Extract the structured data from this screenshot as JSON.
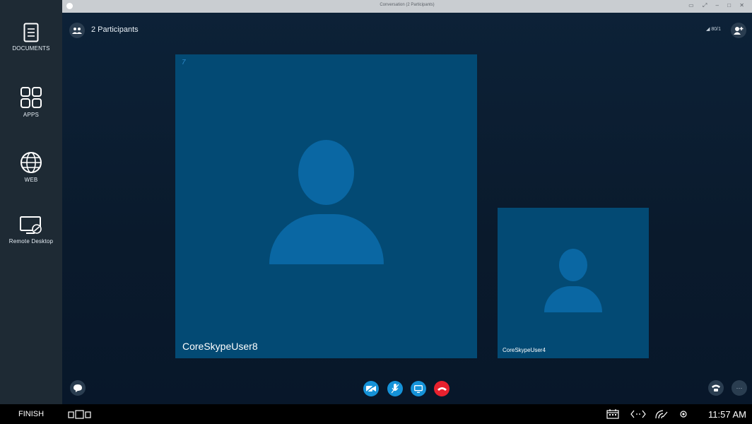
{
  "sidebar": {
    "items": [
      {
        "label": "DOCUMENTS",
        "icon": "documents-icon"
      },
      {
        "label": "APPS",
        "icon": "apps-grid-icon"
      },
      {
        "label": "WEB",
        "icon": "globe-icon"
      },
      {
        "label": "Remote Desktop",
        "icon": "remote-desktop-icon"
      }
    ]
  },
  "window": {
    "title": "Conversation (2 Participants)",
    "controls": "▭ ⤢ – □ ✕"
  },
  "header": {
    "participants_label": "2 Participants",
    "signal_text": "◢  80/1"
  },
  "participants": [
    {
      "name": "CoreSkypeUser8",
      "badge": "7"
    },
    {
      "name": "CoreSkypeUser4"
    }
  ],
  "controls": [
    {
      "name": "video",
      "color": "#1592d8"
    },
    {
      "name": "mute",
      "color": "#1592d8"
    },
    {
      "name": "share",
      "color": "#1592d8"
    },
    {
      "name": "hang-up",
      "color": "#e8212e"
    }
  ],
  "taskbar": {
    "finish_label": "FINISH",
    "clock": "11:57 AM"
  },
  "colors": {
    "sidebar_bg": "#1e2a34",
    "tile_bg": "#034a74",
    "avatar": "#0a67a3",
    "accent": "#1592d8",
    "hangup": "#e8212e"
  }
}
